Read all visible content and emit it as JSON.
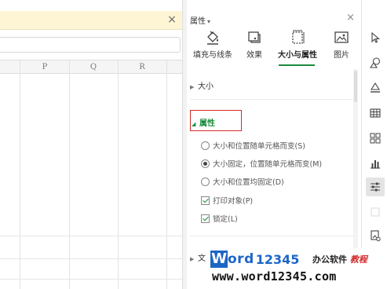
{
  "sheet": {
    "column_headers": [
      "P",
      "Q",
      "R"
    ],
    "notify_close": "×"
  },
  "pane": {
    "title": "属性",
    "title_caret": "▾",
    "close": "×",
    "tabs": [
      {
        "label": "填充与线条",
        "icon": "fill-line-icon",
        "active": false
      },
      {
        "label": "效果",
        "icon": "effects-icon",
        "active": false
      },
      {
        "label": "大小与属性",
        "icon": "size-properties-icon",
        "active": true
      },
      {
        "label": "图片",
        "icon": "picture-icon",
        "active": false
      }
    ],
    "sections": {
      "size": {
        "label": "大小",
        "caret": "▶",
        "expanded": false
      },
      "attributes": {
        "label": "属性",
        "caret": "◢",
        "expanded": true
      },
      "text": {
        "label": "文",
        "caret": "▶",
        "expanded": false
      }
    },
    "options": {
      "radios": [
        {
          "label": "大小和位置随单元格而变(S)",
          "checked": false
        },
        {
          "label": "大小固定，位置随单元格而变(M)",
          "checked": true
        },
        {
          "label": "大小和位置均固定(D)",
          "checked": false
        }
      ],
      "checks": [
        {
          "label": "打印对象(P)",
          "checked": true
        },
        {
          "label": "锁定(L)",
          "checked": true
        }
      ]
    },
    "accent_color": "#1b8c3e",
    "highlight_color": "#d22a2a"
  },
  "side_toolbar": [
    {
      "icon": "select-cursor-icon",
      "active": false
    },
    {
      "icon": "shapes-icon",
      "active": false
    },
    {
      "icon": "fill-bucket-icon",
      "active": false
    },
    {
      "icon": "table-icon",
      "active": false
    },
    {
      "icon": "grid-blocks-icon",
      "active": false
    },
    {
      "icon": "bar-chart-icon",
      "active": false
    },
    {
      "icon": "properties-sliders-icon",
      "active": true
    },
    {
      "icon": "disabled-tool-icon",
      "active": false
    },
    {
      "icon": "picture-settings-icon",
      "active": false
    }
  ],
  "watermark": {
    "logo_w": "W",
    "logo_rest": "ord",
    "logo_num": "12345",
    "cn_text": "办公软件",
    "cn_accent": "教程",
    "url": "www.word12345.com",
    "brand_color": "#1d66c6"
  }
}
